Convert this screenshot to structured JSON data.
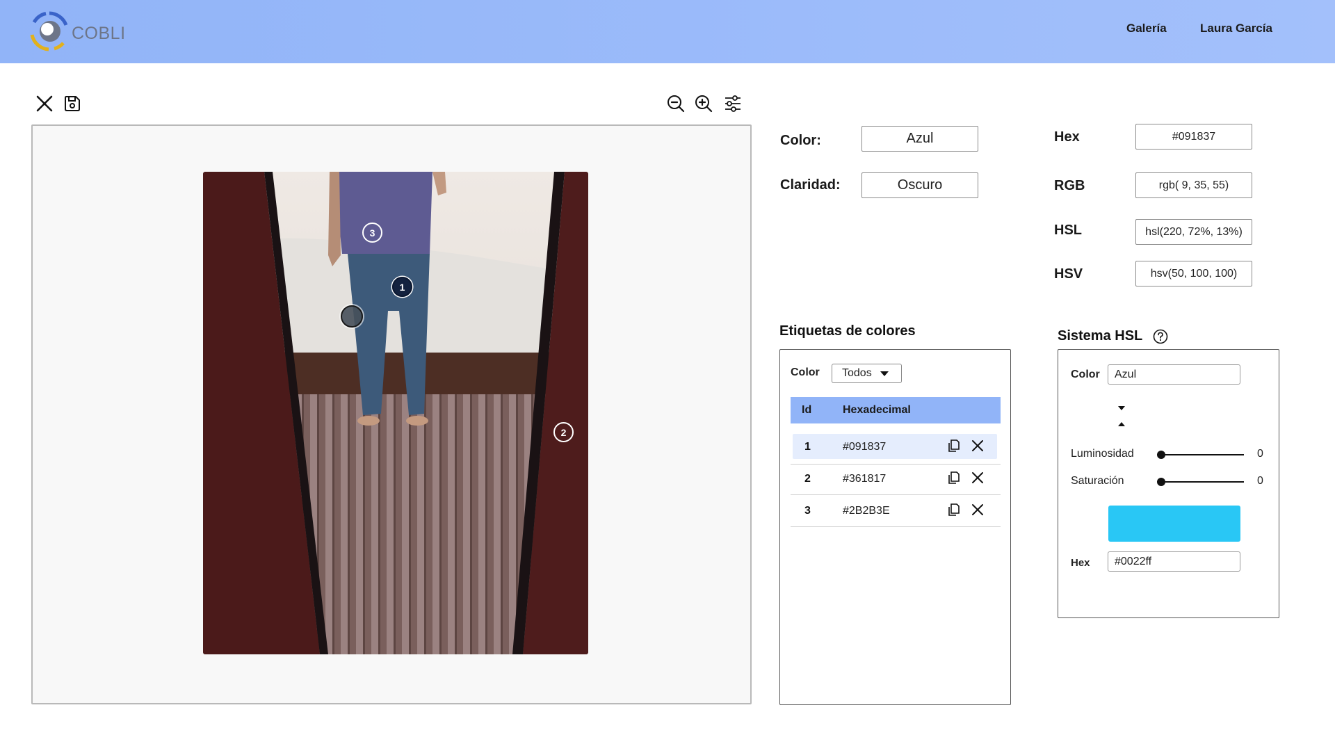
{
  "header": {
    "brand": "COBLI",
    "nav": {
      "gallery": "Galería",
      "user": "Laura García"
    }
  },
  "toolbar": {
    "close_icon": "close-icon",
    "save_icon": "save-icon",
    "zoom_out_icon": "zoom-out-icon",
    "zoom_in_icon": "zoom-in-icon",
    "settings_icon": "sliders-icon"
  },
  "viewer": {
    "markers": [
      {
        "id": "1"
      },
      {
        "id": "2"
      },
      {
        "id": "3"
      }
    ]
  },
  "color_info": {
    "color_label": "Color:",
    "color_value": "Azul",
    "clarity_label": "Claridad:",
    "clarity_value": "Oscuro",
    "hex_label": "Hex",
    "hex_value": "#091837",
    "rgb_label": "RGB",
    "rgb_value": "rgb( 9, 35, 55)",
    "hsl_label": "HSL",
    "hsl_value": "hsl(220, 72%, 13%)",
    "hsv_label": "HSV",
    "hsv_value": "hsv(50, 100, 100)"
  },
  "tags": {
    "title": "Etiquetas de colores",
    "filter_label": "Color",
    "filter_value": "Todos",
    "columns": {
      "id": "Id",
      "hex": "Hexadecimal"
    },
    "rows": [
      {
        "id": "1",
        "hex": "#091837"
      },
      {
        "id": "2",
        "hex": "#361817"
      },
      {
        "id": "3",
        "hex": "#2B2B3E"
      }
    ]
  },
  "hsl_system": {
    "title": "Sistema HSL",
    "color_label": "Color",
    "color_value": "Azul",
    "luminosity_label": "Luminosidad",
    "luminosity_value": "0",
    "saturation_label": "Saturación",
    "saturation_value": "0",
    "hex_label": "Hex",
    "hex_value": "#0022ff",
    "swatch_color": "#29c7f5"
  },
  "colors": {
    "accent": "#91b4f8",
    "selected_row": "#e5edfd"
  }
}
